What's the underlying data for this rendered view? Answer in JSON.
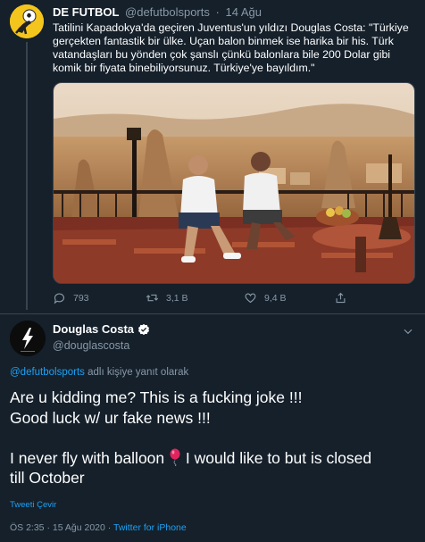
{
  "parent_tweet": {
    "display_name": "DE FUTBOL",
    "handle": "@defutbolsports",
    "separator": "·",
    "date": "14 Ağu",
    "text": "Tatilini Kapadokya'da geçiren Juventus'un yıldızı Douglas Costa: \"Türkiye gerçekten fantastik bir ülke. Uçan balon binmek ise harika bir his. Türk vatandaşları bu yönden çok şanslı çünkü balonlara bile 200 Dolar gibi komik bir fiyata binebiliyorsunuz. Türkiye'ye bayıldım.\"",
    "actions": {
      "reply_count": "793",
      "retweet_count": "3,1 B",
      "like_count": "9,4 B"
    }
  },
  "main_tweet": {
    "display_name": "Douglas Costa",
    "handle": "@douglascosta",
    "reply_to_handle": "@defutbolsports",
    "reply_to_suffix": " adlı kişiye yanıt olarak",
    "text_lines": {
      "line1": "Are u kidding me? This is a fucking joke !!!",
      "line2": "Good luck w/ ur fake news !!!",
      "line3": "I never fly with balloon",
      "line3_after": " I would like to but is closed",
      "line4": "till October"
    },
    "translate_label": "Tweeti Çevir",
    "time": "ÖS 2:35",
    "separator": " · ",
    "date": "15 Ağu 2020",
    "source": "Twitter for iPhone"
  },
  "icons": {
    "reply": "reply-icon",
    "retweet": "retweet-icon",
    "like": "heart-icon",
    "share": "share-icon",
    "verified": "verified-badge-icon",
    "more": "chevron-down-icon",
    "balloon": "balloon-emoji-icon"
  },
  "colors": {
    "background": "#15202b",
    "text": "#ffffff",
    "secondary": "#8899a6",
    "link": "#1da1f2",
    "divider": "#38444d"
  }
}
